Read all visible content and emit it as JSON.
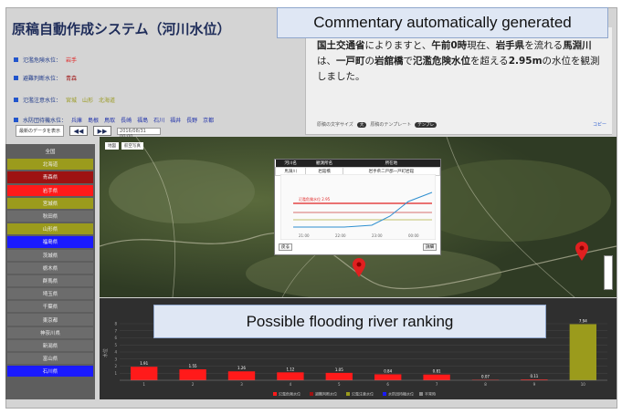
{
  "app_title": "原稿自動作成システム（河川水位）",
  "callouts": {
    "top": "Commentary automatically generated",
    "bottom": "Possible flooding river ranking"
  },
  "levels": [
    {
      "label": "氾濫危険水位：",
      "values": [
        "岩手"
      ],
      "color": "#e02020"
    },
    {
      "label": "避難判断水位：",
      "values": [
        "青森"
      ],
      "color": "#a01818"
    },
    {
      "label": "氾濫注意水位：",
      "values": [
        "宮城",
        "山形",
        "北海道"
      ],
      "color": "#9a9a20"
    },
    {
      "label": "水防団待機水位：",
      "values": [
        "兵庫",
        "島根",
        "鳥取",
        "長崎",
        "福島",
        "石川",
        "福井",
        "長野",
        "京都"
      ],
      "color": "#2233aa"
    }
  ],
  "controls": {
    "save_label": "最新のデータを表示",
    "prev": "◀◀",
    "next": "▶▶",
    "date_value": "2016/08/31 00:00"
  },
  "commentary": {
    "parts": [
      "国土交通省",
      "によりますと、",
      "午前0時",
      "現在、",
      "岩手県",
      "を流れる",
      "馬淵川",
      "は、",
      "一戸町",
      "の",
      "岩舘橋",
      "で",
      "氾濫危険水位",
      "を超える",
      "2.95m",
      "の水位を観測しました。"
    ],
    "font_size_label": "原稿の文字サイズ",
    "font_size_value": "大",
    "template_label": "原稿のテンプレート",
    "template_value": "テンプレ",
    "copy_link": "コピー"
  },
  "sidebar": [
    {
      "name": "全国",
      "color": "#5e5e5e"
    },
    {
      "name": "北海道",
      "color": "#9b9b1c"
    },
    {
      "name": "青森県",
      "color": "#9e1212"
    },
    {
      "name": "岩手県",
      "color": "#ff1a1a"
    },
    {
      "name": "宮城県",
      "color": "#9b9b1c"
    },
    {
      "name": "秋田県",
      "color": "#6c6c6c"
    },
    {
      "name": "山形県",
      "color": "#9b9b1c"
    },
    {
      "name": "福島県",
      "color": "#1a1aff"
    },
    {
      "name": "茨城県",
      "color": "#6c6c6c"
    },
    {
      "name": "栃木県",
      "color": "#6c6c6c"
    },
    {
      "name": "群馬県",
      "color": "#6c6c6c"
    },
    {
      "name": "埼玉県",
      "color": "#6c6c6c"
    },
    {
      "name": "千葉県",
      "color": "#6c6c6c"
    },
    {
      "name": "東京都",
      "color": "#6c6c6c"
    },
    {
      "name": "神奈川県",
      "color": "#6c6c6c"
    },
    {
      "name": "新潟県",
      "color": "#6c6c6c"
    },
    {
      "name": "富山県",
      "color": "#6c6c6c"
    },
    {
      "name": "石川県",
      "color": "#1a1aff"
    }
  ],
  "map": {
    "buttons": [
      "地図",
      "航空写真"
    ],
    "popup": {
      "headers": [
        "河川名",
        "観測所名",
        "所在地"
      ],
      "row": [
        "馬淵川",
        "岩舘橋",
        "岩手県二戸郡一戸町岩舘"
      ],
      "line_label": "氾濫危険水位 2.95",
      "times": [
        "21:00",
        "22:00",
        "23:00",
        "00:00"
      ],
      "btn_left": "戻る",
      "btn_right": "詳細"
    }
  },
  "chart_data": {
    "type": "bar",
    "title": "",
    "ylabel": "水位",
    "categories": [
      "1",
      "2",
      "3",
      "4",
      "5",
      "6",
      "7",
      "8",
      "9",
      "10"
    ],
    "values": [
      1.91,
      1.55,
      1.26,
      1.12,
      1.05,
      0.84,
      0.81,
      0.07,
      0.11,
      7.94
    ],
    "bar_colors": [
      "#ff1a1a",
      "#ff1a1a",
      "#ff1a1a",
      "#ff1a1a",
      "#ff1a1a",
      "#ff1a1a",
      "#ff1a1a",
      "#ff1a1a",
      "#ff1a1a",
      "#9b9b1c"
    ],
    "ylim": [
      0,
      8
    ],
    "yticks": [
      1,
      2,
      3,
      4,
      5,
      6,
      7,
      8
    ],
    "legend": [
      "氾濫危険水位",
      "避難判断水位",
      "氾濫注意水位",
      "水防団待機水位",
      "平常時"
    ],
    "legend_colors": [
      "#ff1a1a",
      "#9e1212",
      "#9b9b1c",
      "#1a1aff",
      "#888888"
    ]
  }
}
